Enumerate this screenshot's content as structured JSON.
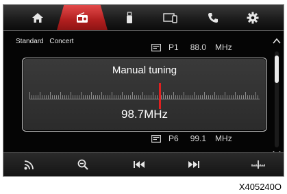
{
  "tabs": [
    {
      "name": "home-icon"
    },
    {
      "name": "radio-icon",
      "active": true
    },
    {
      "name": "usb-media-icon"
    },
    {
      "name": "phone-projection-icon"
    },
    {
      "name": "phone-icon"
    },
    {
      "name": "settings-gear-icon"
    }
  ],
  "modes": {
    "standard": "Standard",
    "concert": "Concert"
  },
  "presets": {
    "top": {
      "name": "P1",
      "freq": "88.0",
      "unit": "MHz"
    },
    "bottom": {
      "name": "P6",
      "freq": "99.1",
      "unit": "MHz"
    }
  },
  "tuning": {
    "title": "Manual tuning",
    "frequency": "98.7MHz"
  },
  "bottom_bar": [
    {
      "name": "rds-signal-icon"
    },
    {
      "name": "search-zoom-out-icon"
    },
    {
      "name": "previous-track-icon"
    },
    {
      "name": "next-track-icon"
    },
    {
      "name": "manual-tune-icon"
    }
  ],
  "caption": "X405240O",
  "colors": {
    "accent": "#c62828",
    "tick": "#8a8a8a",
    "marker": "#e02020"
  }
}
